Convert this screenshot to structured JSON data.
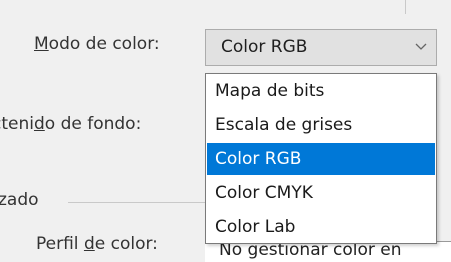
{
  "color_mode": {
    "label_rest": "odo de color:",
    "mnemonic": "M",
    "selected_value": "Color RGB",
    "options": [
      "Mapa de bits",
      "Escala de grises",
      "Color RGB",
      "Color CMYK",
      "Color Lab"
    ],
    "selected_index": 2
  },
  "background": {
    "label_before": "cteni",
    "mnemonic": "d",
    "label_after": "o de fondo:"
  },
  "section": {
    "title": "zado"
  },
  "color_profile": {
    "mnemonic": "d",
    "label_before": "Perfil ",
    "label_after": "e color:",
    "value": "No gestionar color en"
  },
  "colors": {
    "accent": "#0078d7",
    "window_bg": "#f0f0f0",
    "select_bg": "#e1e1e1"
  }
}
